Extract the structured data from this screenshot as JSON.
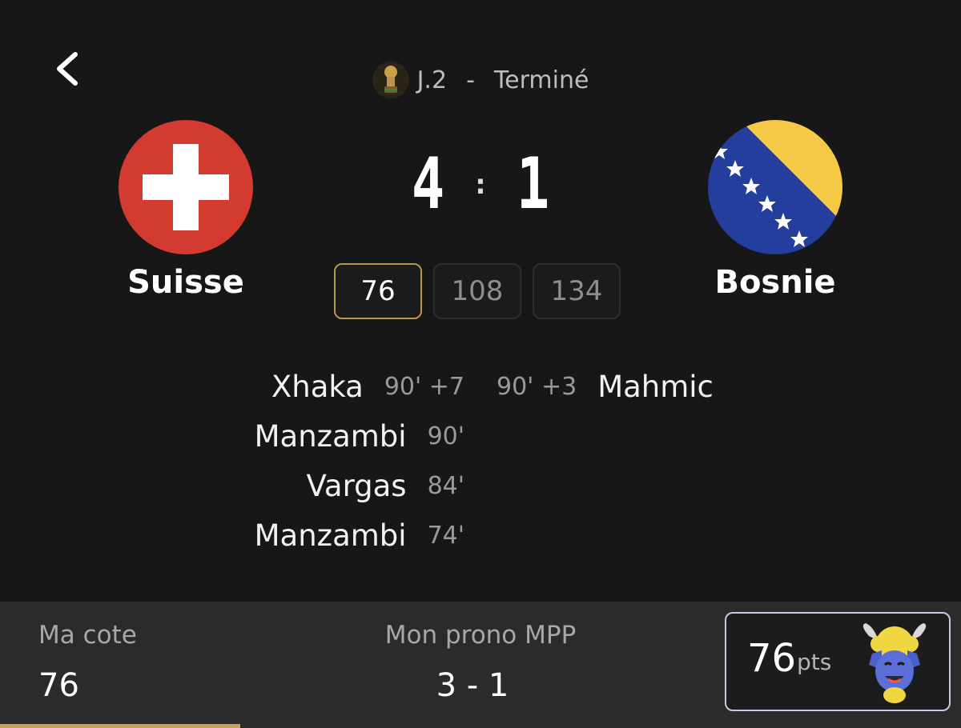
{
  "header": {
    "matchday": "J.2",
    "separator": "-",
    "status": "Terminé",
    "competition_icon": "trophy-icon"
  },
  "match": {
    "home": {
      "name": "Suisse",
      "flag": "switzerland-flag",
      "score": "4"
    },
    "away": {
      "name": "Bosnie",
      "flag": "bosnia-flag",
      "score": "1"
    },
    "score_separator": ":"
  },
  "odds": [
    {
      "value": "76",
      "selected": true
    },
    {
      "value": "108",
      "selected": false
    },
    {
      "value": "134",
      "selected": false
    }
  ],
  "scorers": {
    "home": [
      {
        "name": "Xhaka",
        "minute": "90' +7"
      },
      {
        "name": "Manzambi",
        "minute": "90'"
      },
      {
        "name": "Vargas",
        "minute": "84'"
      },
      {
        "name": "Manzambi",
        "minute": "74'"
      }
    ],
    "away": [
      {
        "name": "Mahmic",
        "minute": "90' +3"
      }
    ]
  },
  "footer": {
    "cote_label": "Ma cote",
    "cote_value": "76",
    "prono_label": "Mon prono MPP",
    "prono_value": "3 - 1",
    "points_value": "76",
    "points_unit": "pts",
    "progress_fraction": 0.25
  },
  "colors": {
    "background": "#171717",
    "accent_gold": "#b8954a",
    "footer_bg": "#2b2b2b"
  }
}
